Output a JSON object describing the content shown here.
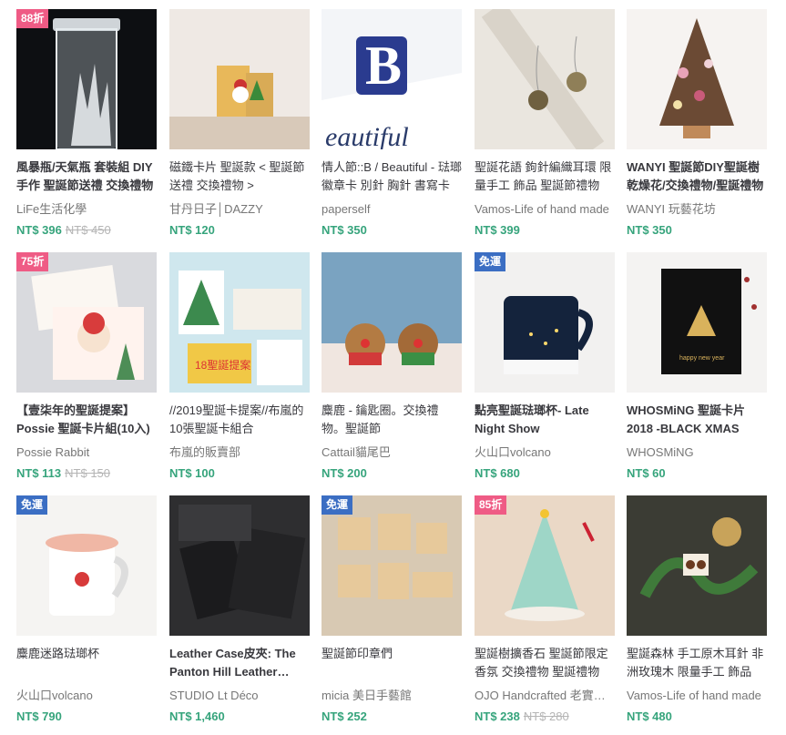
{
  "products": [
    {
      "title": "風暴瓶/天氣瓶 套裝組 DIY 手作 聖誕節送禮 交換禮物",
      "bold": true,
      "shop": "LiFe生活化學",
      "price": "NT$ 396",
      "old_price": "NT$ 450",
      "badge": "88折",
      "badge_type": "discount"
    },
    {
      "title": "磁鐵卡片 聖誕款 < 聖誕節 送禮 交換禮物 >",
      "bold": false,
      "shop": "甘丹日子│DAZZY",
      "price": "NT$ 120",
      "old_price": "",
      "badge": "",
      "badge_type": ""
    },
    {
      "title": "情人節::B / Beautiful - 琺瑯徽章卡 別針 胸針 書寫卡",
      "bold": false,
      "shop": "paperself",
      "price": "NT$ 350",
      "old_price": "",
      "badge": "",
      "badge_type": ""
    },
    {
      "title": "聖誕花語 鉤針編織耳環 限量手工 飾品 聖誕節禮物",
      "bold": false,
      "shop": "Vamos-Life of hand made",
      "price": "NT$ 399",
      "old_price": "",
      "badge": "",
      "badge_type": ""
    },
    {
      "title": "WANYI 聖誕節DIY聖誕樹 乾燥花/交換禮物/聖誕禮物",
      "bold": true,
      "shop": "WANYI 玩藝花坊",
      "price": "NT$ 350",
      "old_price": "",
      "badge": "",
      "badge_type": ""
    },
    {
      "title": "【壹柒年的聖誕提案】Possie 聖誕卡片組(10入)",
      "bold": true,
      "shop": "Possie Rabbit",
      "price": "NT$ 113",
      "old_price": "NT$ 150",
      "badge": "75折",
      "badge_type": "discount"
    },
    {
      "title": "//2019聖誕卡提案//布嵐的10張聖誕卡組合",
      "bold": false,
      "shop": "布嵐的販賣部",
      "price": "NT$ 100",
      "old_price": "",
      "badge": "",
      "badge_type": ""
    },
    {
      "title": "麋鹿 - 鑰匙圈。交換禮物。聖誕節",
      "bold": false,
      "shop": "Cattail貓尾巴",
      "price": "NT$ 200",
      "old_price": "",
      "badge": "",
      "badge_type": ""
    },
    {
      "title": "點亮聖誕琺瑯杯- Late Night Show",
      "bold": true,
      "shop": "火山口volcano",
      "price": "NT$ 680",
      "old_price": "",
      "badge": "免運",
      "badge_type": "express"
    },
    {
      "title": "WHOSMiNG 聖誕卡片 2018 -BLACK XMAS",
      "bold": true,
      "shop": "WHOSMiNG",
      "price": "NT$ 60",
      "old_price": "",
      "badge": "",
      "badge_type": ""
    },
    {
      "title": "麋鹿迷路琺瑯杯",
      "bold": false,
      "shop": "火山口volcano",
      "price": "NT$ 790",
      "old_price": "",
      "badge": "免運",
      "badge_type": "express"
    },
    {
      "title": "Leather Case皮夾: The Panton Hill Leather Wallet",
      "bold": true,
      "shop": "STUDIO Lt Déco",
      "price": "NT$ 1,460",
      "old_price": "",
      "badge": "",
      "badge_type": ""
    },
    {
      "title": "聖誕節印章們",
      "bold": false,
      "shop": "micia 美日手藝館",
      "price": "NT$ 252",
      "old_price": "",
      "badge": "免運",
      "badge_type": "express"
    },
    {
      "title": "聖誕樹擴香石 聖誕節限定 香氛 交換禮物 聖誕禮物",
      "bold": false,
      "shop": "OJO Handcrafted 老實手作",
      "price": "NT$ 238",
      "old_price": "NT$ 280",
      "badge": "85折",
      "badge_type": "discount"
    },
    {
      "title": "聖誕森林 手工原木耳針 非洲玫瑰木 限量手工 飾品",
      "bold": false,
      "shop": "Vamos-Life of hand made",
      "price": "NT$ 480",
      "old_price": "",
      "badge": "",
      "badge_type": ""
    }
  ]
}
